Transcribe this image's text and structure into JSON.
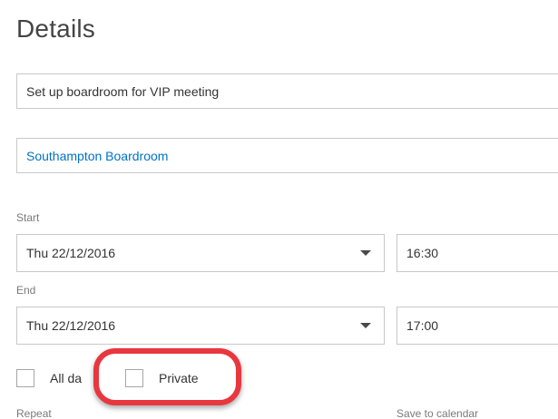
{
  "details": {
    "heading": "Details",
    "title_value": "Set up boardroom for VIP meeting",
    "location_value": "Southampton Boardroom"
  },
  "start": {
    "label": "Start",
    "date": "Thu 22/12/2016",
    "time": "16:30"
  },
  "end": {
    "label": "End",
    "date": "Thu 22/12/2016",
    "time": "17:00"
  },
  "options": {
    "all_day_label": "All da",
    "private_label": "Private"
  },
  "footer": {
    "repeat_label": "Repeat",
    "save_to_label": "Save to calendar"
  },
  "colors": {
    "location_link": "#0072c6",
    "highlight": "#e8373f"
  }
}
